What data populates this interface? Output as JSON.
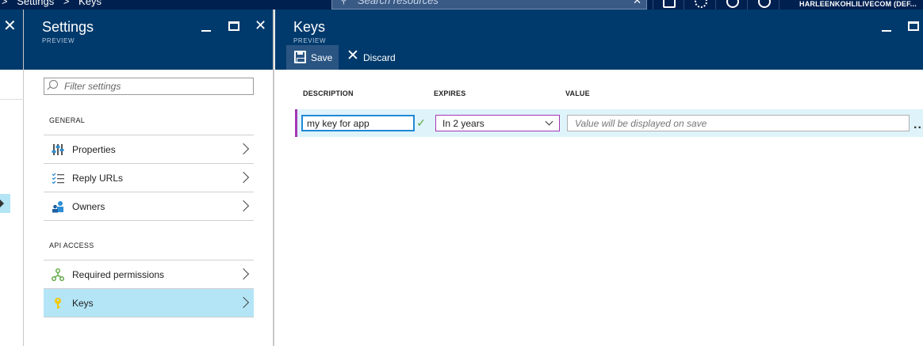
{
  "topbar": {
    "breadcrumb": [
      "Settings",
      "Keys"
    ],
    "search_placeholder": "Search resources",
    "user": "HARLEENKOHLILIVECOM (DEF..."
  },
  "settings": {
    "title": "Settings",
    "subtitle": "PREVIEW",
    "filter_placeholder": "Filter settings",
    "groups": [
      {
        "label": "GENERAL",
        "items": [
          {
            "label": "Properties",
            "icon": "sliders-icon"
          },
          {
            "label": "Reply URLs",
            "icon": "checklist-icon"
          },
          {
            "label": "Owners",
            "icon": "people-icon"
          }
        ]
      },
      {
        "label": "API ACCESS",
        "items": [
          {
            "label": "Required permissions",
            "icon": "network-icon"
          },
          {
            "label": "Keys",
            "icon": "key-icon",
            "selected": true
          }
        ]
      }
    ]
  },
  "keys": {
    "title": "Keys",
    "subtitle": "PREVIEW",
    "toolbar": {
      "save_label": "Save",
      "discard_label": "Discard"
    },
    "columns": [
      "DESCRIPTION",
      "EXPIRES",
      "VALUE"
    ],
    "row": {
      "description": "my key for app",
      "expires": "In 2 years",
      "value_placeholder": "Value will be displayed on save"
    }
  },
  "colors": {
    "header_bg": "#003a6c",
    "topbar_bg": "#002050",
    "selected_bg": "#b3e5f6",
    "accent_purple": "#a437b5",
    "valid_green": "#5aa53c"
  }
}
